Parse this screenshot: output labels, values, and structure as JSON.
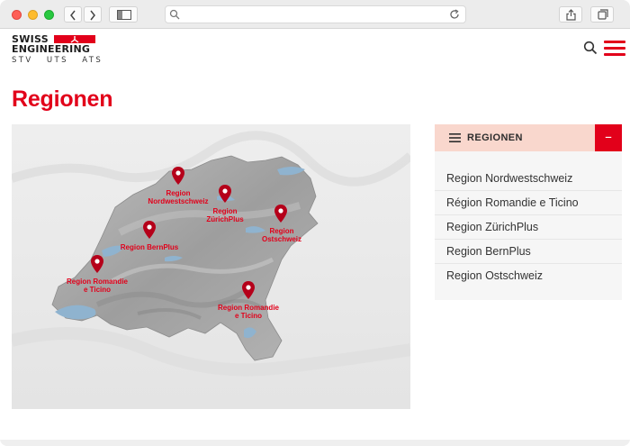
{
  "browser": {
    "nav_back_icon": "chevron-left",
    "nav_forward_icon": "chevron-right",
    "address_value": ""
  },
  "logo": {
    "line1": "SWISS",
    "line2": "ENGINEERING",
    "line3": "STV   UTS   ATS",
    "accent": "#e2001a"
  },
  "page": {
    "title": "Regionen"
  },
  "map": {
    "pins": [
      {
        "name": "nordwestschweiz",
        "label_lines": [
          "Region",
          "Nordwestschweiz"
        ]
      },
      {
        "name": "zuerichplus",
        "label_lines": [
          "Region",
          "ZürichPlus"
        ]
      },
      {
        "name": "ostschweiz",
        "label_lines": [
          "Region",
          "Ostschweiz"
        ]
      },
      {
        "name": "bernplus",
        "label_lines": [
          "Region BernPlus"
        ]
      },
      {
        "name": "romandie-west",
        "label_lines": [
          "Region Romandie",
          "e Ticino"
        ]
      },
      {
        "name": "romandie-ticino",
        "label_lines": [
          "Region Romandie",
          "e Ticino"
        ]
      }
    ]
  },
  "sidebar": {
    "title": "REGIONEN",
    "toggle": "–",
    "items": [
      {
        "label": "Region Nordwestschweiz"
      },
      {
        "label": "Région Romandie e Ticino"
      },
      {
        "label": "Region ZürichPlus"
      },
      {
        "label": "Region BernPlus"
      },
      {
        "label": "Region Ostschweiz"
      }
    ]
  },
  "colors": {
    "brand_red": "#e2001a",
    "accordion_header": "#f9d7cd",
    "accordion_bg": "#f6f6f6"
  }
}
